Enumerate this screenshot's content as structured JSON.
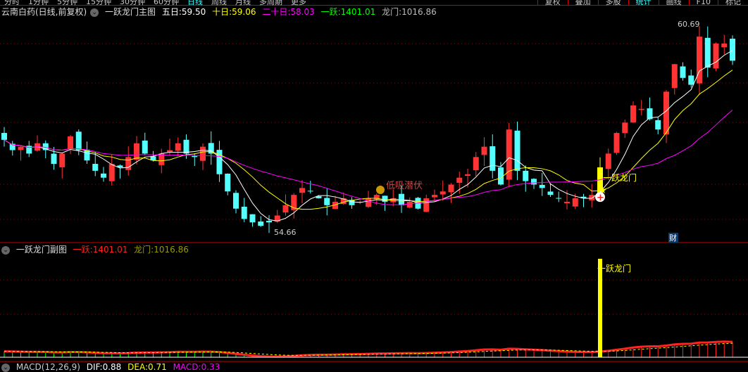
{
  "topbar": {
    "periods": [
      "分时",
      "1分钟",
      "5分钟",
      "15分钟",
      "30分钟",
      "60分钟",
      "日线",
      "周线",
      "月线",
      "多周期",
      "更多"
    ],
    "active": "日线",
    "tools": [
      "复权",
      "叠加",
      "多股",
      "统计",
      "画线",
      "F10",
      "标记"
    ],
    "active_tool": "统计"
  },
  "main_header": {
    "stock": "云南白药(日线,前复权)",
    "indicator": "一跃龙门主图",
    "ma5_label": "五日:",
    "ma5": "59.50",
    "ma10_label": "十日:",
    "ma10": "59.06",
    "ma20_label": "二十日:",
    "ma20": "58.03",
    "yiyue_label": "一跃:",
    "yiyue": "1401.01",
    "longmen_label": "龙门:",
    "longmen": "1016.86"
  },
  "sub_header": {
    "indicator": "一跃龙门副图",
    "yiyue_label": "一跃:",
    "yiyue": "1401.01",
    "longmen_label": "龙门:",
    "longmen": "1016.86"
  },
  "bottom_header": {
    "indicator": "MACD(12,26,9)",
    "dif_label": "DIF:",
    "dif": "0.88",
    "dea_label": "DEA:",
    "dea": "0.71",
    "macd_label": "MACD:",
    "macd": "0.33"
  },
  "annotations": {
    "high": "60.69",
    "low": "54.66",
    "signal": "一跃龙门",
    "sub_signal": "一跃龙门",
    "strategy": "低吸潜伏",
    "cai": "财"
  },
  "colors": {
    "up": "#ff3333",
    "down": "#54ffff",
    "ma5": "#ffffff",
    "ma10": "#ffff00",
    "ma20": "#ff00ff",
    "grid": "#a00000"
  },
  "chart_data": {
    "type": "candlestick",
    "price_range": [
      54.2,
      61.3
    ],
    "closes": [
      57.3,
      57.0,
      57.1,
      56.9,
      57.2,
      57.0,
      56.6,
      56.9,
      57.4,
      57.0,
      56.7,
      56.4,
      56.2,
      56.6,
      56.5,
      56.8,
      57.2,
      56.9,
      56.7,
      56.9,
      57.0,
      57.2,
      56.9,
      56.8,
      57.1,
      56.9,
      56.3,
      55.8,
      55.3,
      55.0,
      54.9,
      54.8,
      54.9,
      55.1,
      55.4,
      55.7,
      55.9,
      55.8,
      55.6,
      55.4,
      55.5,
      55.6,
      55.4,
      55.5,
      55.6,
      55.7,
      55.5,
      55.6,
      55.4,
      55.5,
      55.3,
      55.6,
      55.7,
      55.8,
      56.0,
      56.2,
      56.3,
      56.8,
      57.1,
      56.4,
      56.0,
      57.6,
      56.4,
      56.1,
      56.0,
      55.9,
      55.7,
      55.6,
      55.5,
      55.6,
      55.6,
      55.7,
      56.5,
      56.9,
      57.5,
      57.8,
      58.3,
      58.2,
      57.9,
      57.6,
      58.7,
      59.5,
      59.1,
      58.9,
      60.3,
      59.4,
      60.1,
      60.1,
      59.6
    ],
    "signal_index": 72
  }
}
